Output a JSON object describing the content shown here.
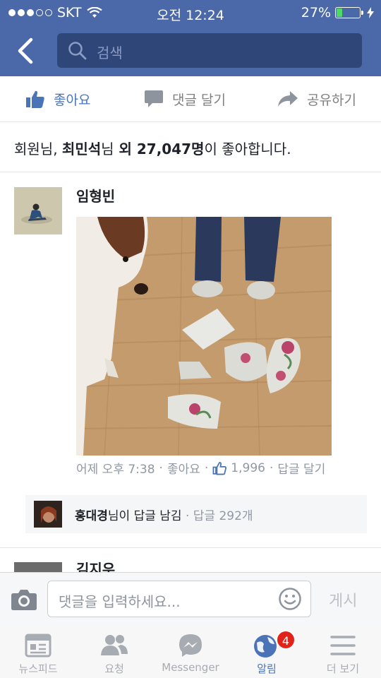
{
  "status": {
    "carrier": "SKT",
    "time": "오전 12:24",
    "battery": "27%",
    "battery_level": 0.27
  },
  "search": {
    "placeholder": "검색"
  },
  "actions": {
    "like": "좋아요",
    "comment": "댓글 달기",
    "share": "공유하기"
  },
  "likes": {
    "you": "회원님",
    "sep": ", ",
    "friend": "최민석",
    "nim": "님",
    "others": " 외 ",
    "count": "27,047명",
    "suffix": "이 좋아합니다."
  },
  "comment": {
    "name": "임형빈",
    "time": "어제 오후 7:38",
    "like": "좋아요",
    "like_count": "1,996",
    "reply": "답글 달기",
    "dot": "·"
  },
  "reply_summary": {
    "name": "홍대경",
    "text": "님이 답글 남김",
    "count": "답글 292개"
  },
  "next_comment": {
    "name": "김지우"
  },
  "composer": {
    "placeholder": "댓글을 입력하세요...",
    "post": "게시"
  },
  "tabs": [
    {
      "label": "뉴스피드"
    },
    {
      "label": "요청"
    },
    {
      "label": "Messenger"
    },
    {
      "label": "알림",
      "badge": "4"
    },
    {
      "label": "더 보기"
    }
  ],
  "colors": {
    "brand": "#4b68a8",
    "accent": "#4b74b8",
    "badge": "#e2231a"
  }
}
